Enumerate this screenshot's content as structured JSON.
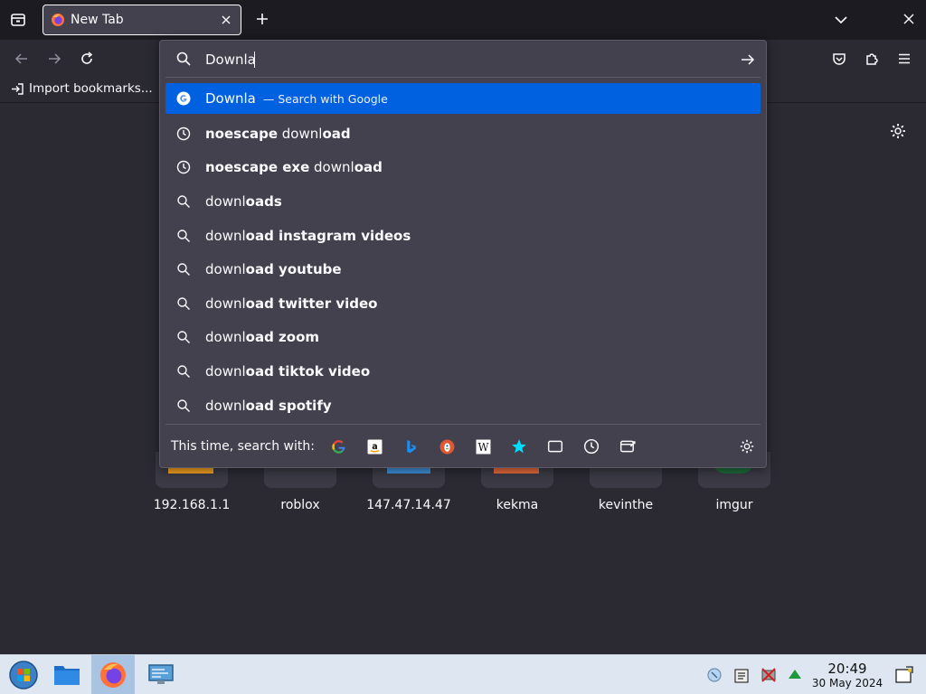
{
  "tab": {
    "title": "New Tab"
  },
  "bookmarks": {
    "import_label": "Import bookmarks..."
  },
  "urlbar": {
    "value": "Downla",
    "results": [
      {
        "type": "engine",
        "icon": "google-icon",
        "pre": "Downla",
        "bold": "",
        "action": "— Search with Google"
      },
      {
        "type": "history",
        "icon": "clock-icon",
        "pre": "",
        "bold": "noescape",
        "mid": " downl",
        "tail": "oad"
      },
      {
        "type": "history",
        "icon": "clock-icon",
        "pre": "",
        "bold": "noescape exe",
        "mid": " downl",
        "tail": "oad"
      },
      {
        "type": "suggest",
        "icon": "search-icon",
        "pre": "downl",
        "bold": "oads"
      },
      {
        "type": "suggest",
        "icon": "search-icon",
        "pre": "downl",
        "bold": "oad instagram videos"
      },
      {
        "type": "suggest",
        "icon": "search-icon",
        "pre": "downl",
        "bold": "oad youtube"
      },
      {
        "type": "suggest",
        "icon": "search-icon",
        "pre": "downl",
        "bold": "oad twitter video"
      },
      {
        "type": "suggest",
        "icon": "search-icon",
        "pre": "downl",
        "bold": "oad zoom"
      },
      {
        "type": "suggest",
        "icon": "search-icon",
        "pre": "downl",
        "bold": "oad tiktok video"
      },
      {
        "type": "suggest",
        "icon": "search-icon",
        "pre": "downl",
        "bold": "oad spotify"
      }
    ],
    "oneoff_label": "This time, search with:",
    "engines": [
      "google-icon",
      "amazon-icon",
      "bing-icon",
      "duckduckgo-icon",
      "wikipedia-icon",
      "bookmarks-star-icon",
      "tabs-icon",
      "history-icon",
      "actions-icon"
    ]
  },
  "topsites": [
    {
      "label": "192.168.1.1"
    },
    {
      "label": "roblox"
    },
    {
      "label": "147.47.14.47"
    },
    {
      "label": "kekma"
    },
    {
      "label": "kevinthe"
    },
    {
      "label": "imgur"
    }
  ],
  "clock": {
    "time": "20:49",
    "date": "30 May 2024"
  },
  "colors": {
    "accent": "#0061e0",
    "panel": "#42414d",
    "background": "#2b2a33",
    "tabstrip": "#1c1b22"
  }
}
